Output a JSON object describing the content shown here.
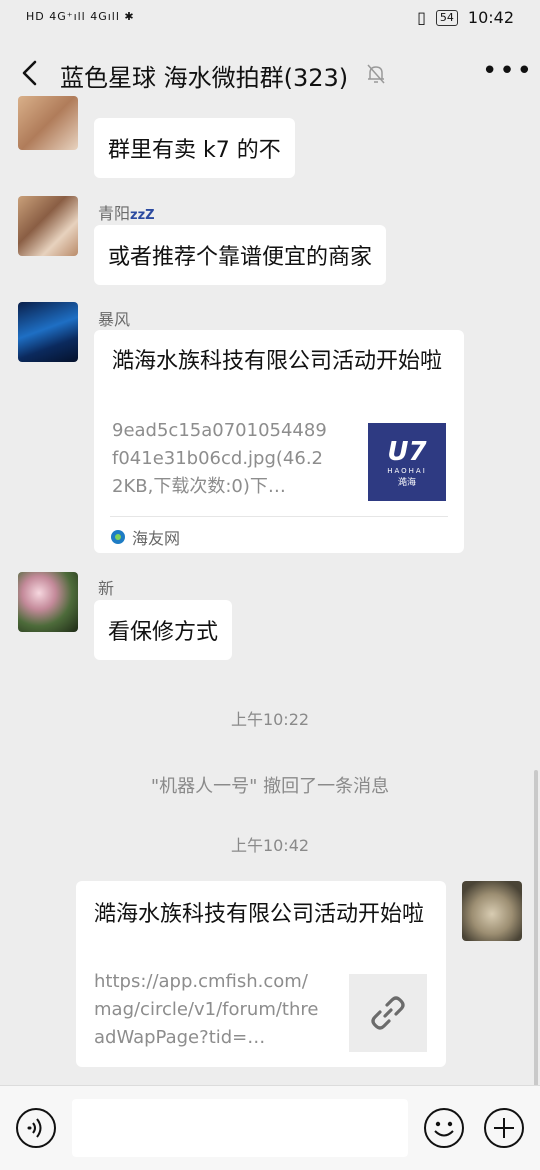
{
  "status": {
    "left_text": "HD 4G⁺ıll 4Gıll ✱",
    "battery": "54",
    "time": "10:42"
  },
  "header": {
    "title": "蓝色星球 海水微拍群(323)"
  },
  "messages": [
    {
      "sender": "青阳z",
      "text": "群里有卖 k7 的不"
    },
    {
      "sender": "青阳",
      "text": "或者推荐个靠谱便宜的商家"
    },
    {
      "sender": "暴风",
      "card": {
        "title": "澔海水族科技有限公司活动开始啦",
        "desc": "9ead5c15a0701054489f041e31b06cd.jpg(46.22KB,下载次数:0)下…",
        "source": "海友网",
        "thumb_logo": "U7",
        "thumb_sub": "HAOHAI",
        "thumb_sub2": "澔海"
      }
    },
    {
      "sender": "新",
      "text": "看保修方式"
    }
  ],
  "timestamps": [
    "上午10:22",
    "上午10:42"
  ],
  "system_notice": "\"机器人一号\" 撤回了一条消息",
  "my_card": {
    "title": "澔海水族科技有限公司活动开始啦",
    "desc": "https://app.cmfish.com/mag/circle/v1/forum/threadWapPage?tid=…"
  },
  "colors": {
    "accent_thumb": "#2e3a82",
    "bg": "#ededed"
  }
}
